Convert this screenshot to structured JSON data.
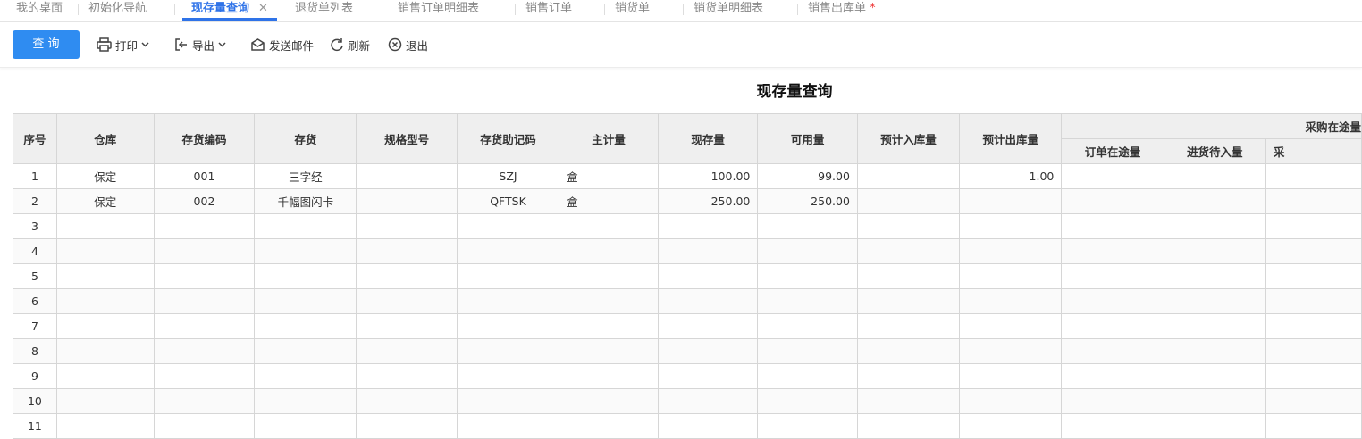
{
  "tabs": [
    {
      "label": "我的桌面"
    },
    {
      "label": "初始化导航"
    },
    {
      "label": "现存量查询",
      "close": "✕"
    },
    {
      "label": "退货单列表"
    },
    {
      "label": "销售订单明细表"
    },
    {
      "label": "销售订单"
    },
    {
      "label": "销货单"
    },
    {
      "label": "销货单明细表"
    },
    {
      "label": "销售出库单",
      "star": "*"
    }
  ],
  "toolbar": {
    "query": "查 询",
    "print": "打印",
    "export": "导出",
    "email": "发送邮件",
    "refresh": "刷新",
    "exit": "退出"
  },
  "page_title": "现存量查询",
  "table": {
    "headers": {
      "seq": "序号",
      "warehouse": "仓库",
      "code": "存货编码",
      "item": "存货",
      "spec": "规格型号",
      "mnemonic": "存货助记码",
      "unit": "主计量",
      "onhand": "现存量",
      "available": "可用量",
      "expected_in": "预计入库量",
      "expected_out": "预计出库量",
      "purchase_transit": "采购在途量",
      "order_transit": "订单在途量",
      "receipt_pending": "进货待入量",
      "cut": "采"
    },
    "rows": [
      {
        "seq": "1",
        "warehouse": "保定",
        "code": "001",
        "item": "三字经",
        "spec": "",
        "mnemonic": "SZJ",
        "unit": "盒",
        "onhand": "100.00",
        "available": "99.00",
        "expected_in": "",
        "expected_out": "1.00"
      },
      {
        "seq": "2",
        "warehouse": "保定",
        "code": "002",
        "item": "千幅图闪卡",
        "spec": "",
        "mnemonic": "QFTSK",
        "unit": "盒",
        "onhand": "250.00",
        "available": "250.00",
        "expected_in": "",
        "expected_out": ""
      },
      {
        "seq": "3"
      },
      {
        "seq": "4"
      },
      {
        "seq": "5"
      },
      {
        "seq": "6"
      },
      {
        "seq": "7"
      },
      {
        "seq": "8"
      },
      {
        "seq": "9"
      },
      {
        "seq": "10"
      },
      {
        "seq": "11"
      }
    ]
  }
}
